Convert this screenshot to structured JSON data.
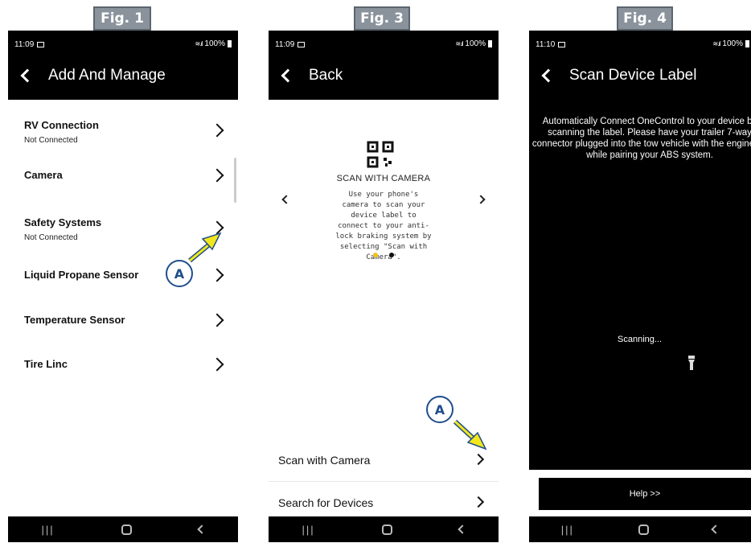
{
  "fig1": {
    "label": "Fig. 1",
    "status": {
      "time": "11:09",
      "battery": "100%"
    },
    "header": {
      "title": "Add And Manage"
    },
    "items": [
      {
        "label": "RV Connection",
        "sub": "Not Connected"
      },
      {
        "label": "Camera",
        "sub": ""
      },
      {
        "label": "Safety Systems",
        "sub": "Not Connected"
      },
      {
        "label": "Liquid Propane Sensor",
        "sub": ""
      },
      {
        "label": "Temperature Sensor",
        "sub": ""
      },
      {
        "label": "Tire Linc",
        "sub": ""
      }
    ],
    "callout": "A"
  },
  "fig3": {
    "label": "Fig. 3",
    "status": {
      "time": "11:09",
      "battery": "100%"
    },
    "header": {
      "title": "Back"
    },
    "scan_title": "SCAN WITH CAMERA",
    "scan_desc": "Use your phone's camera to scan your device label to connect to your anti-lock braking system by selecting \"Scan with Camera\".",
    "menu": [
      {
        "label": "Scan with Camera"
      },
      {
        "label": "Search for Devices"
      }
    ],
    "callout": "A"
  },
  "fig4": {
    "label": "Fig. 4",
    "status": {
      "time": "11:10",
      "battery": "100%"
    },
    "header": {
      "title": "Scan Device Label"
    },
    "info": "Automatically Connect OneControl to your device by scanning the label. Please have your trailer 7-way connector plugged into the tow vehicle with the engine on while pairing your ABS system.",
    "scanning": "Scanning...",
    "help_button": "Help >>"
  },
  "colors": {
    "callout": "#1f4e8c",
    "arrow": "#f2e61c",
    "figlabel": "#8a939c"
  },
  "icons": [
    "back-arrow-icon",
    "chevron-right-icon",
    "qr-code-icon",
    "flashlight-icon",
    "recents-icon",
    "home-icon",
    "nav-back-icon"
  ]
}
